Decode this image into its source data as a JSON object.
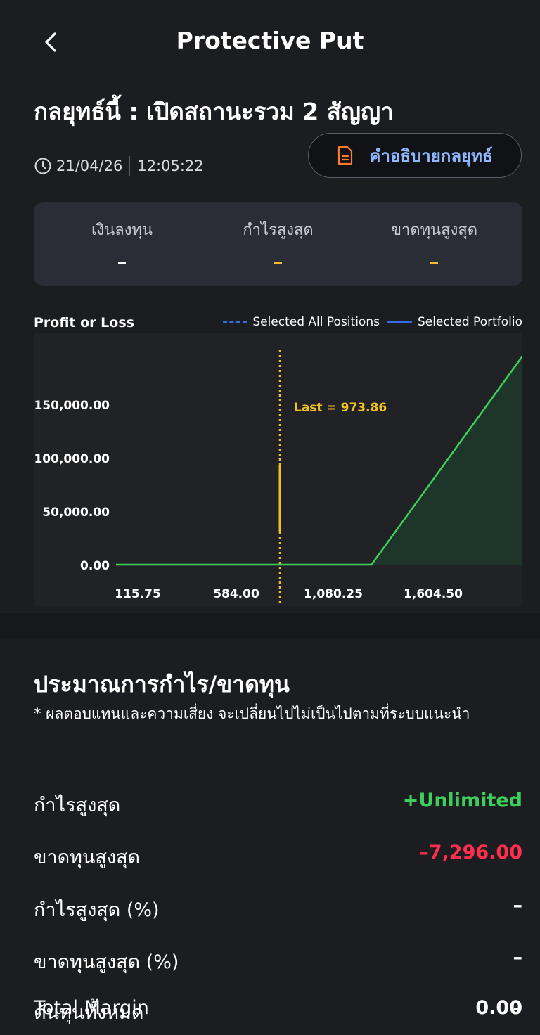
{
  "header": {
    "title": "Protective Put"
  },
  "strategy": {
    "title": "กลยุทธ์นี้ : เปิดสถานะรวม 2 สัญญา",
    "date": "21/04/26",
    "time": "12:05:22",
    "explain_label": "คำอธิบายกลยุทธ์"
  },
  "summary": [
    {
      "label": "เงินลงทุน",
      "value": "–",
      "color": "#ffffff"
    },
    {
      "label": "กำไรสูงสุด",
      "value": "–",
      "color": "#f5b82e"
    },
    {
      "label": "ขาดทุนสูงสุด",
      "value": "–",
      "color": "#f5b82e"
    }
  ],
  "chart_data": {
    "type": "line",
    "title": "Profit or Loss",
    "legend": [
      "Selected All Positions",
      "Selected Portfolio"
    ],
    "y_ticks": [
      "150,000.00",
      "100,000.00",
      "50,000.00",
      "0.00"
    ],
    "x_ticks": [
      "115.75",
      "584.00",
      "1,080.25",
      "1,604.50"
    ],
    "last_label": "Last = 973.86",
    "series": [
      {
        "name": "Selected Portfolio",
        "x": [
          0,
          1100,
          1750
        ],
        "y": [
          0,
          0,
          195000
        ]
      }
    ],
    "colors": {
      "line": "#3ecf5b",
      "last": "#f2c11d",
      "legend": "#2f6fe0"
    }
  },
  "estimate": {
    "title": "ประมาณการกำไร/ขาดทุน",
    "note": "* ผลตอบแทนและความเสี่ยง จะเปลี่ยนไปไม่เป็นไปตามที่ระบบแนะนำ",
    "rows": [
      {
        "label": "กำไรสูงสุด",
        "value": "+Unlimited",
        "color": "#3ecf5b"
      },
      {
        "label": "ขาดทุนสูงสุด",
        "value": "–7,296.00",
        "color": "#ff2e4d"
      },
      {
        "label": "กำไรสูงสุด (%)",
        "value": "–",
        "color": "#ffffff"
      },
      {
        "label": "ขาดทุนสูงสุด (%)",
        "value": "–",
        "color": "#ffffff"
      },
      {
        "label": "ต้นทุนทั้งหมด",
        "value": "–",
        "color": "#ffffff"
      },
      {
        "label": "Total Margin",
        "value": "0.00",
        "color": "#ffffff"
      }
    ]
  }
}
